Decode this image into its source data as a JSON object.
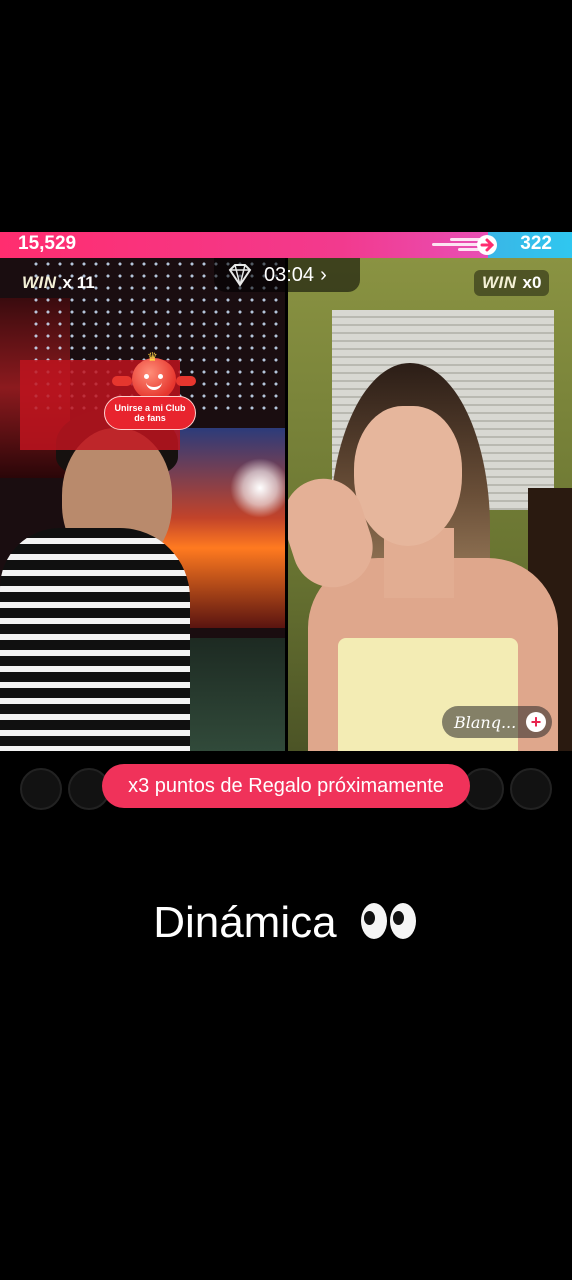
{
  "battle": {
    "left_score": "15,529",
    "right_score": "322",
    "timer": "03:04",
    "timer_chevron": "›",
    "left_win_word": "WIN",
    "left_win_count": "x 11",
    "right_win_word": "WIN",
    "right_win_count": "x0",
    "colors": {
      "left_bar": "#ff2d6f",
      "right_bar": "#3ab6e6"
    }
  },
  "fan_club": {
    "line1": "Unirse a mi Club",
    "line2": "de fans"
  },
  "right_streamer": {
    "name_label": "Blanq...",
    "follow_icon": "plus-icon",
    "follow_symbol": "+"
  },
  "gift_banner": {
    "text": "x3 puntos de Regalo próximamente"
  },
  "caption": {
    "text": "Dinámica"
  }
}
